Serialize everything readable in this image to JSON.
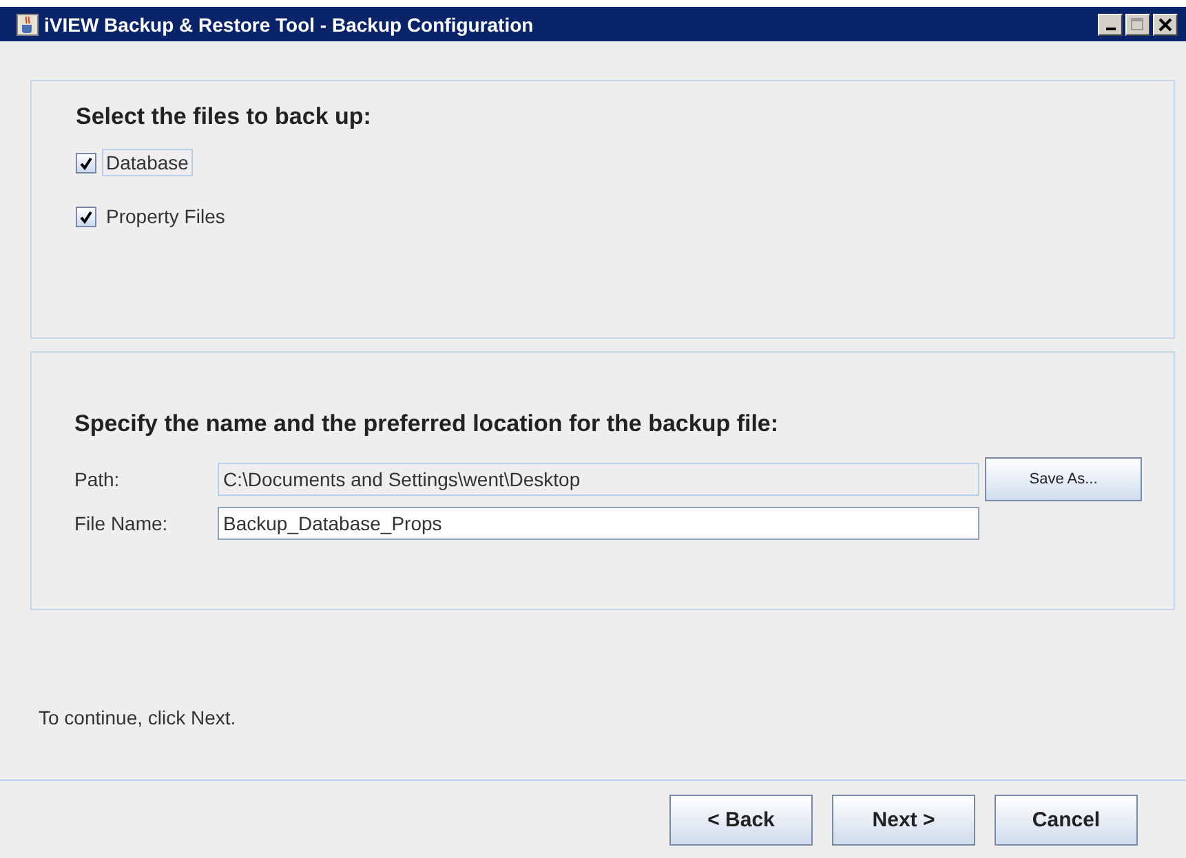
{
  "window": {
    "title": "iVIEW Backup & Restore Tool - Backup Configuration"
  },
  "files_section": {
    "heading": "Select the files to back up:",
    "options": [
      {
        "label": "Database",
        "checked": true,
        "focused": true
      },
      {
        "label": "Property Files",
        "checked": true,
        "focused": false
      }
    ]
  },
  "location_section": {
    "heading": "Specify the name and the preferred location for the backup file:",
    "fields": [
      {
        "label": "Path:",
        "value": "C:\\Documents and Settings\\went\\Desktop",
        "disabled": true,
        "button": "Save As..."
      },
      {
        "label": "File Name:",
        "value": "Backup_Database_Props",
        "disabled": false
      }
    ]
  },
  "hint": "To continue, click Next.",
  "buttons": [
    "< Back",
    "Next >",
    "Cancel"
  ]
}
